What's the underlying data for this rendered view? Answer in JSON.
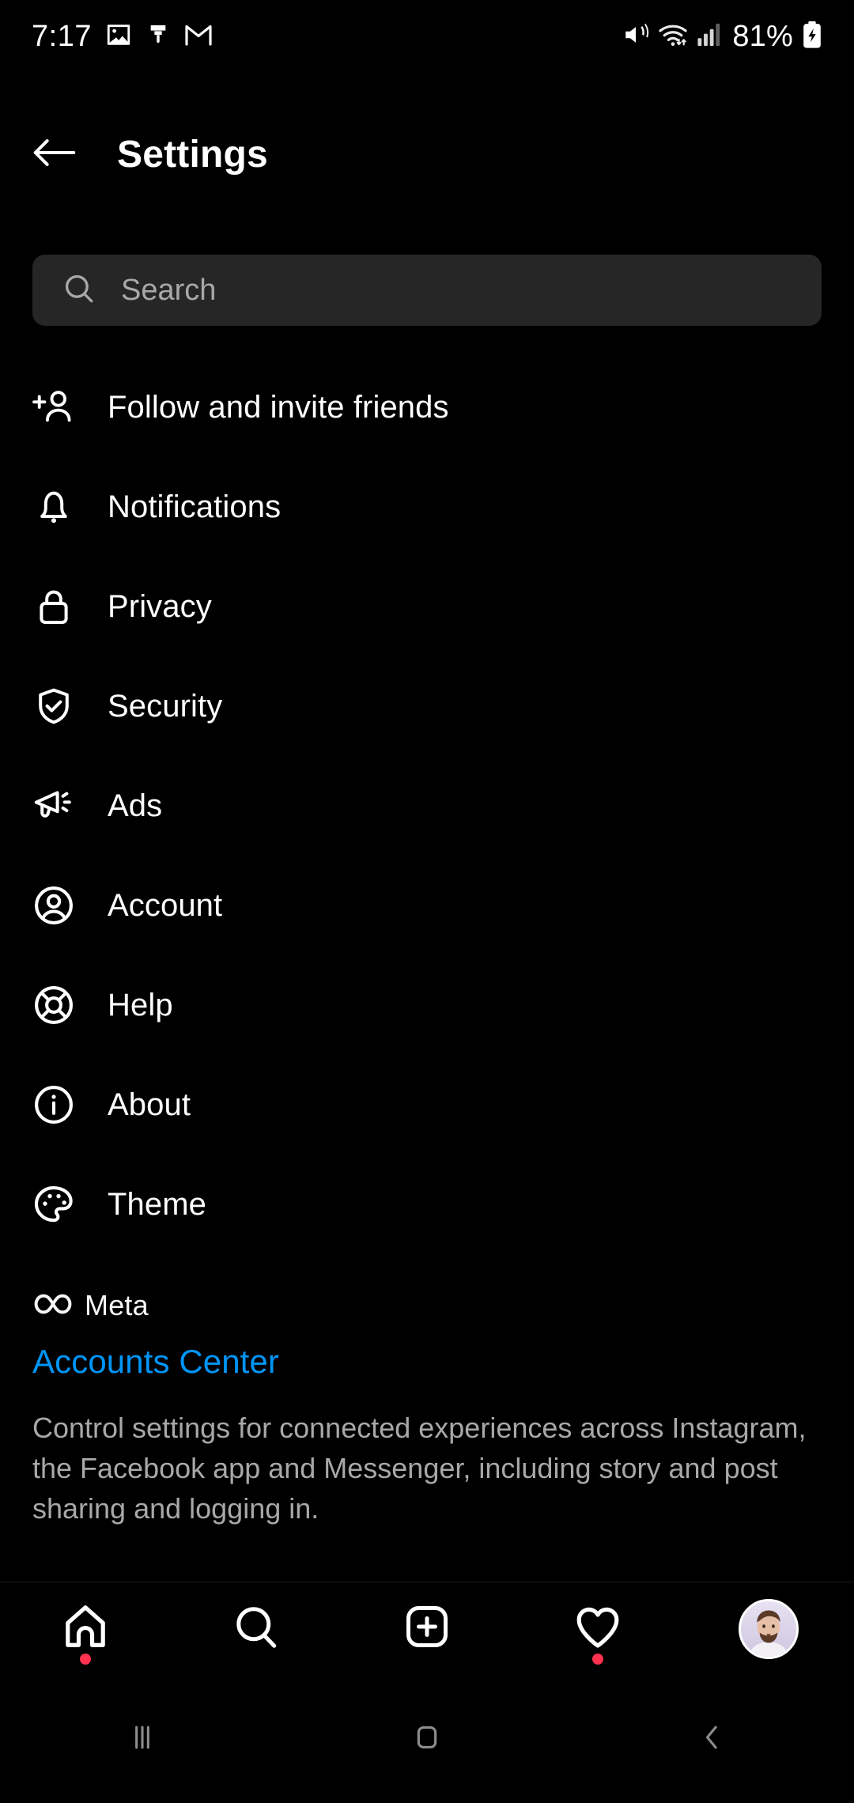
{
  "status_bar": {
    "time": "7:17",
    "battery_percent": "81%",
    "left_icons": [
      "gallery-icon",
      "paint-brush-icon",
      "gmail-icon"
    ],
    "right_icons": [
      "mute-icon",
      "wifi-icon",
      "cellular-signal-icon",
      "battery-charging-icon"
    ]
  },
  "header": {
    "back_icon": "arrow-left-icon",
    "title": "Settings"
  },
  "search": {
    "icon": "search-icon",
    "placeholder": "Search",
    "value": ""
  },
  "menu": {
    "items": [
      {
        "label": "Follow and invite friends",
        "icon": "person-add-icon"
      },
      {
        "label": "Notifications",
        "icon": "bell-icon"
      },
      {
        "label": "Privacy",
        "icon": "lock-icon"
      },
      {
        "label": "Security",
        "icon": "shield-check-icon"
      },
      {
        "label": "Ads",
        "icon": "megaphone-icon"
      },
      {
        "label": "Account",
        "icon": "person-circle-icon"
      },
      {
        "label": "Help",
        "icon": "life-ring-icon"
      },
      {
        "label": "About",
        "icon": "info-circle-icon"
      },
      {
        "label": "Theme",
        "icon": "palette-icon"
      }
    ]
  },
  "meta_section": {
    "brand_icon": "meta-infinity-icon",
    "brand_name": "Meta",
    "link_label": "Accounts Center",
    "link_color": "#0095f6",
    "description": "Control settings for connected experiences across Instagram, the Facebook app and Messenger, including story and post sharing and logging in."
  },
  "tab_bar": {
    "items": [
      {
        "name": "home",
        "icon": "home-icon",
        "badge_dot": true
      },
      {
        "name": "search",
        "icon": "search-icon",
        "badge_dot": false
      },
      {
        "name": "create",
        "icon": "plus-square-icon",
        "badge_dot": false
      },
      {
        "name": "activity",
        "icon": "heart-icon",
        "badge_dot": true
      },
      {
        "name": "profile",
        "icon": "avatar-icon",
        "badge_dot": false
      }
    ],
    "badge_color": "#ff3250"
  },
  "android_nav": {
    "recents_icon": "recents-icon",
    "home_icon": "home-square-icon",
    "back_icon": "chevron-left-icon"
  }
}
